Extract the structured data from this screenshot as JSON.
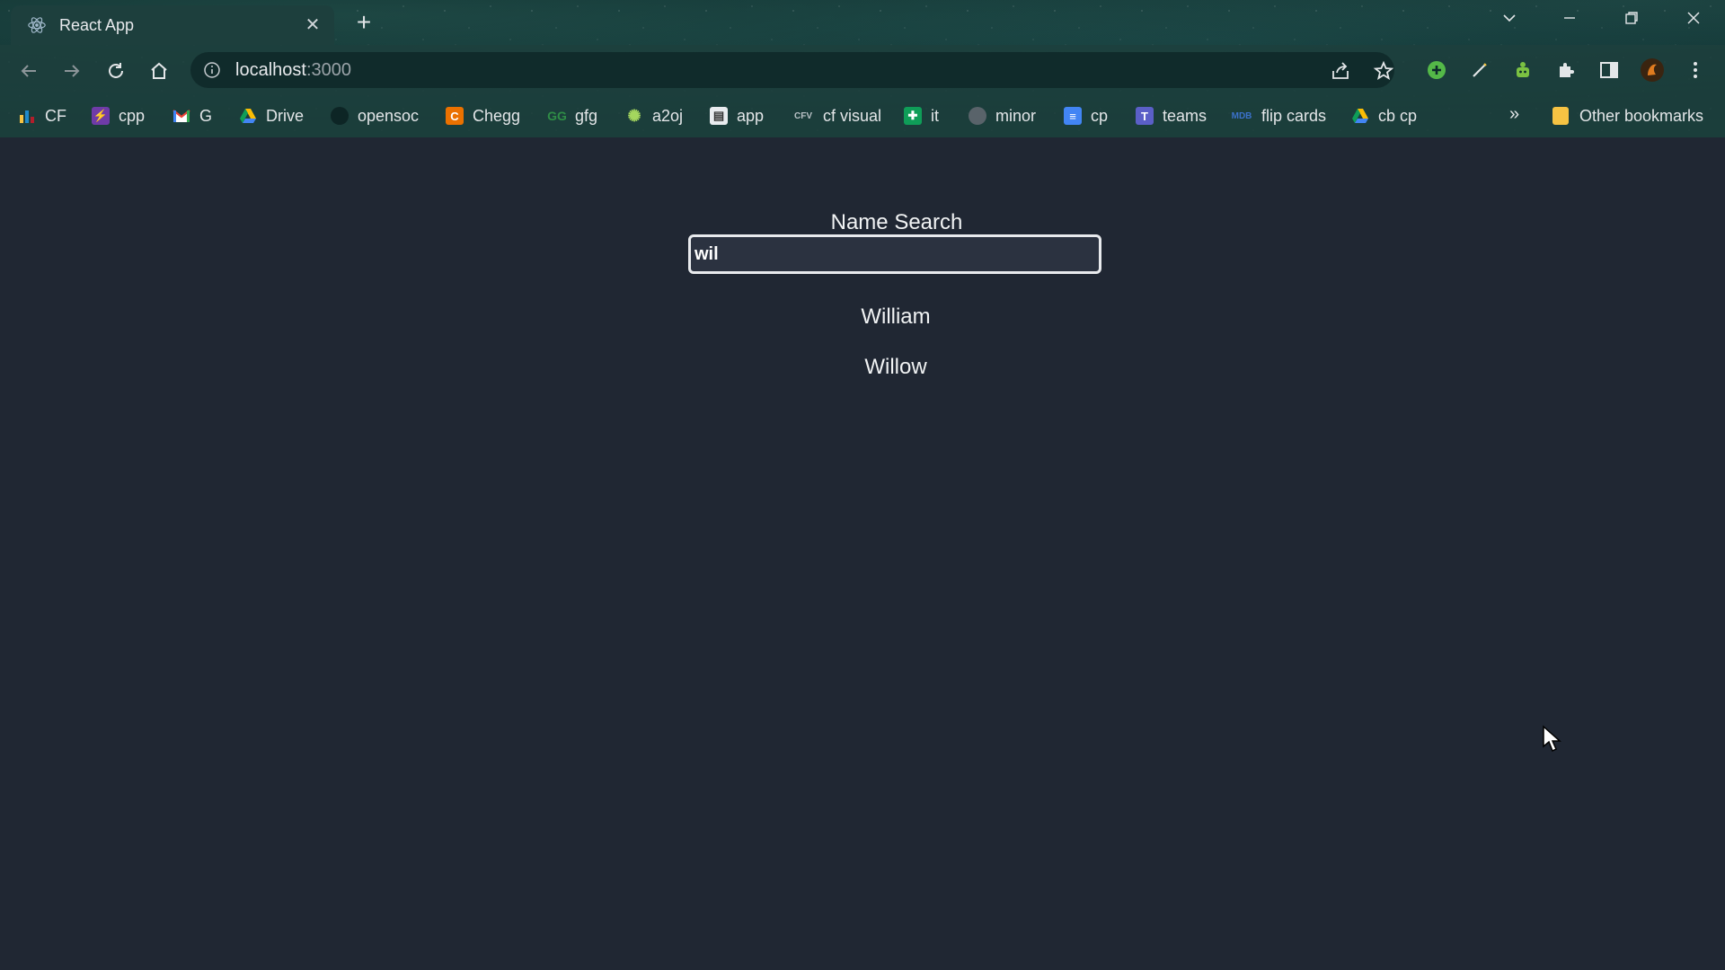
{
  "browser": {
    "tab": {
      "title": "React App",
      "favicon": "react-atom-icon"
    },
    "address_bar": {
      "host": "localhost",
      "port": ":3000"
    },
    "nav_icons": [
      "back-arrow-icon",
      "forward-arrow-icon",
      "reload-icon",
      "home-icon"
    ],
    "toolbar_icons": [
      "share-icon",
      "bookmark-star-icon",
      "extension-plus-icon",
      "pen-icon",
      "extension-robot-icon",
      "puzzle-icon",
      "side-panel-icon",
      "profile-avatar-icon",
      "kebab-menu-icon"
    ],
    "window_controls": [
      "tab-search-icon",
      "minimize-icon",
      "restore-icon",
      "close-window-icon"
    ],
    "bookmarks": [
      {
        "label": "CF",
        "icon": "bar-chart-icon"
      },
      {
        "label": "cpp",
        "icon": "bolt-icon"
      },
      {
        "label": "G",
        "icon": "gmail-icon"
      },
      {
        "label": "Drive",
        "icon": "drive-icon"
      },
      {
        "label": "opensoc",
        "icon": "github-icon"
      },
      {
        "label": "Chegg",
        "icon": "chegg-icon"
      },
      {
        "label": "gfg",
        "icon": "gfg-icon"
      },
      {
        "label": "a2oj",
        "icon": "gear-face-icon"
      },
      {
        "label": "app",
        "icon": "notebook-icon"
      },
      {
        "label": "cf visual",
        "icon": "cfv-icon"
      },
      {
        "label": "it",
        "icon": "sheets-icon"
      },
      {
        "label": "minor",
        "icon": "globe-icon"
      },
      {
        "label": "cp",
        "icon": "docs-icon"
      },
      {
        "label": "teams",
        "icon": "teams-icon"
      },
      {
        "label": "flip cards",
        "icon": "mdb-icon"
      },
      {
        "label": "cb cp",
        "icon": "drive-icon"
      }
    ],
    "more_bookmarks": "»",
    "other_bookmarks": {
      "label": "Other bookmarks",
      "icon": "folder-icon"
    }
  },
  "app": {
    "heading": "Name Search",
    "search": {
      "value": "wil"
    },
    "results": [
      "William",
      "Willow"
    ]
  },
  "colors": {
    "page_background": "#202733",
    "chrome_background": "#123634",
    "text": "#f1f3f4",
    "input_border": "#e8eaed"
  }
}
